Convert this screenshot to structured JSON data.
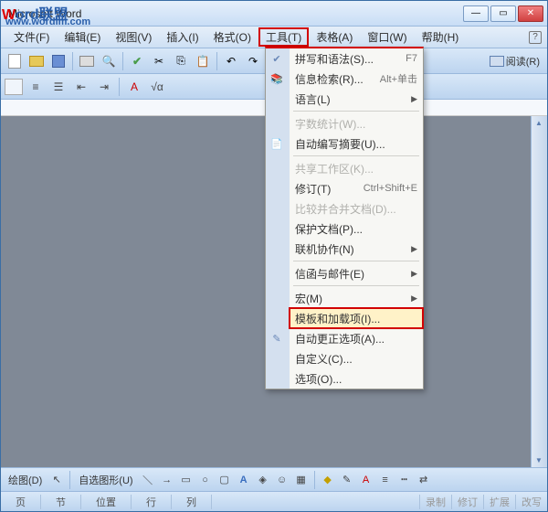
{
  "title": "Microsoft Word",
  "watermark": {
    "w": "W",
    "rest": "ord联盟",
    "url": "www.wordlm.com"
  },
  "winControls": {
    "min": "—",
    "max": "▭",
    "close": "✕"
  },
  "menubar": {
    "file": "文件(F)",
    "edit": "编辑(E)",
    "view": "视图(V)",
    "insert": "插入(I)",
    "format": "格式(O)",
    "tools": "工具(T)",
    "table": "表格(A)",
    "window": "窗口(W)",
    "help": "帮助(H)",
    "q": "?"
  },
  "toolbar1": {
    "read": "阅读(R)"
  },
  "toolbar2": {
    "math": "√α"
  },
  "dropdown": {
    "items": [
      {
        "label": "拼写和语法(S)...",
        "shortcut": "F7",
        "disabled": false,
        "icon": "✔"
      },
      {
        "label": "信息检索(R)...",
        "shortcut": "Alt+单击",
        "disabled": false,
        "icon": "📚"
      },
      {
        "label": "语言(L)",
        "arrow": "▶",
        "disabled": false
      },
      {
        "sep": true
      },
      {
        "label": "字数统计(W)...",
        "disabled": true
      },
      {
        "label": "自动编写摘要(U)...",
        "disabled": false,
        "icon": "📄"
      },
      {
        "sep": true
      },
      {
        "label": "共享工作区(K)...",
        "disabled": true
      },
      {
        "label": "修订(T)",
        "shortcut": "Ctrl+Shift+E",
        "disabled": false
      },
      {
        "label": "比较并合并文档(D)...",
        "disabled": true
      },
      {
        "label": "保护文档(P)...",
        "disabled": false
      },
      {
        "label": "联机协作(N)",
        "arrow": "▶",
        "disabled": false
      },
      {
        "sep": true
      },
      {
        "label": "信函与邮件(E)",
        "arrow": "▶",
        "disabled": false
      },
      {
        "sep": true
      },
      {
        "label": "宏(M)",
        "arrow": "▶",
        "disabled": false
      },
      {
        "label": "模板和加载项(I)...",
        "disabled": false,
        "highlight": true
      },
      {
        "label": "自动更正选项(A)...",
        "disabled": false,
        "icon": "✎"
      },
      {
        "label": "自定义(C)...",
        "disabled": false
      },
      {
        "label": "选项(O)...",
        "disabled": false
      }
    ]
  },
  "bottombar": {
    "draw": "绘图(D)",
    "autoshape": "自选图形(U)"
  },
  "statusbar": {
    "cells": [
      "页",
      "节",
      "位置",
      "行",
      "列"
    ],
    "modes": [
      "录制",
      "修订",
      "扩展",
      "改写"
    ]
  }
}
